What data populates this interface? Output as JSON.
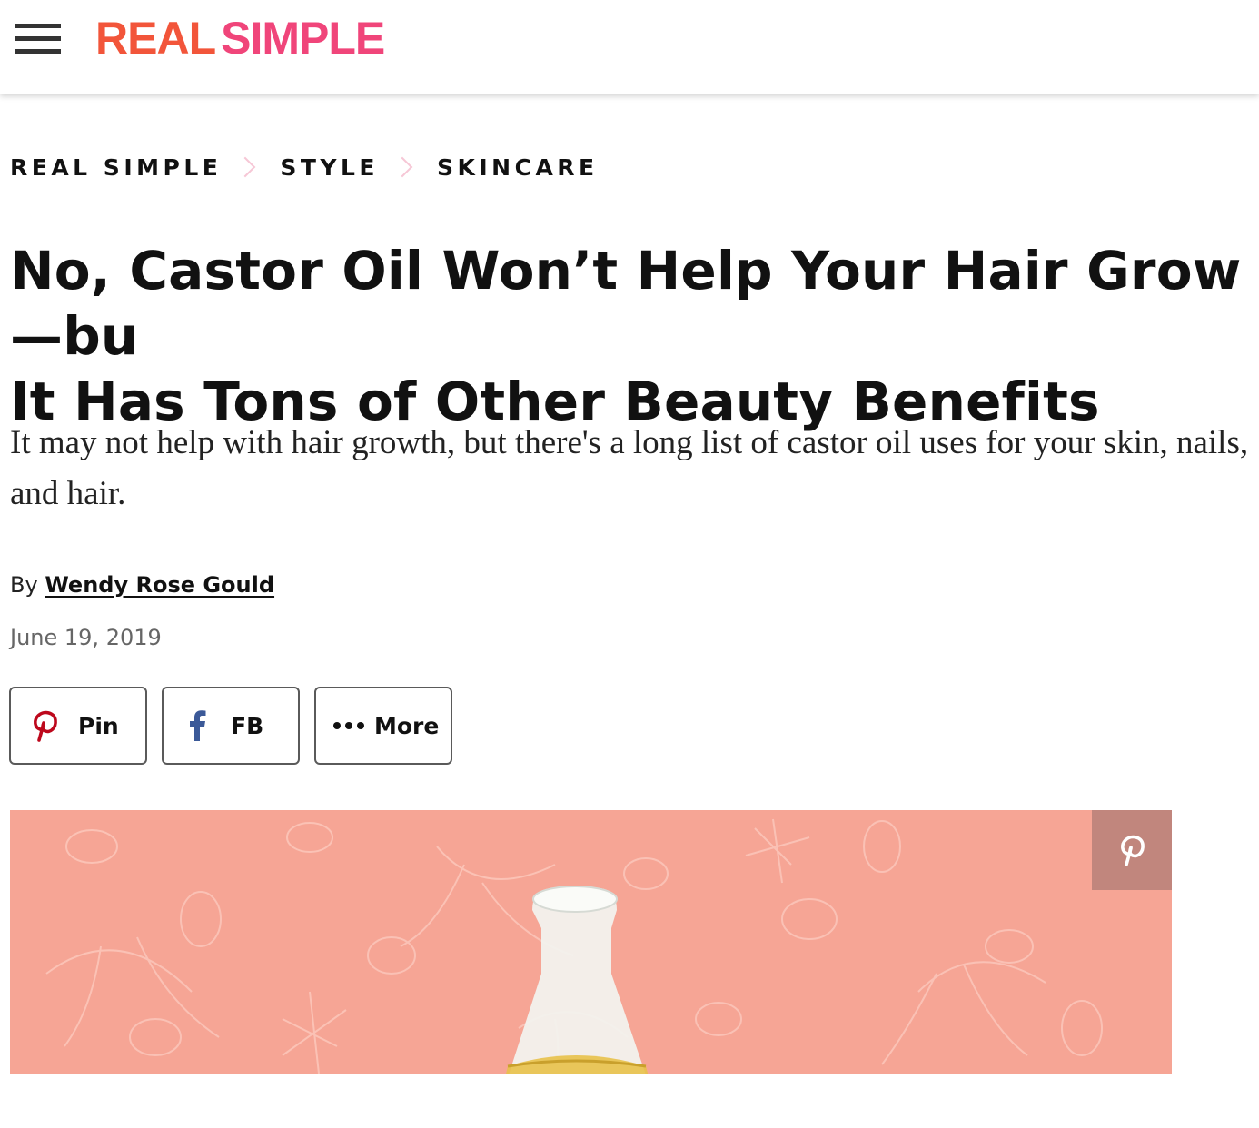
{
  "header": {
    "logo_real": "REAL",
    "logo_simple": "SIMPLE",
    "logo_colors": {
      "real": "#f2553a",
      "simple": "#f0457a"
    },
    "menu_icon": "hamburger-menu-icon"
  },
  "breadcrumb": {
    "items": [
      "REAL SIMPLE",
      "STYLE",
      "SKINCARE"
    ],
    "separator_color": "#f6c7d6"
  },
  "article": {
    "title_line1": "No, Castor Oil Won’t Help Your Hair Grow—bu",
    "title_line2": "It Has Tons of Other Beauty Benefits",
    "dek": "It may not help with hair growth, but there's a long list of castor oil uses for your skin, nails, and hair.",
    "byline_prefix": "By",
    "author": "Wendy Rose Gould",
    "date": "June 19, 2019"
  },
  "share": {
    "pin_label": "Pin",
    "fb_label": "FB",
    "more_label": "More",
    "pin_color": "#bd081c",
    "fb_color": "#3b5998"
  },
  "hero": {
    "background_color": "#f6a595",
    "overlay_icon": "pinterest-icon"
  }
}
